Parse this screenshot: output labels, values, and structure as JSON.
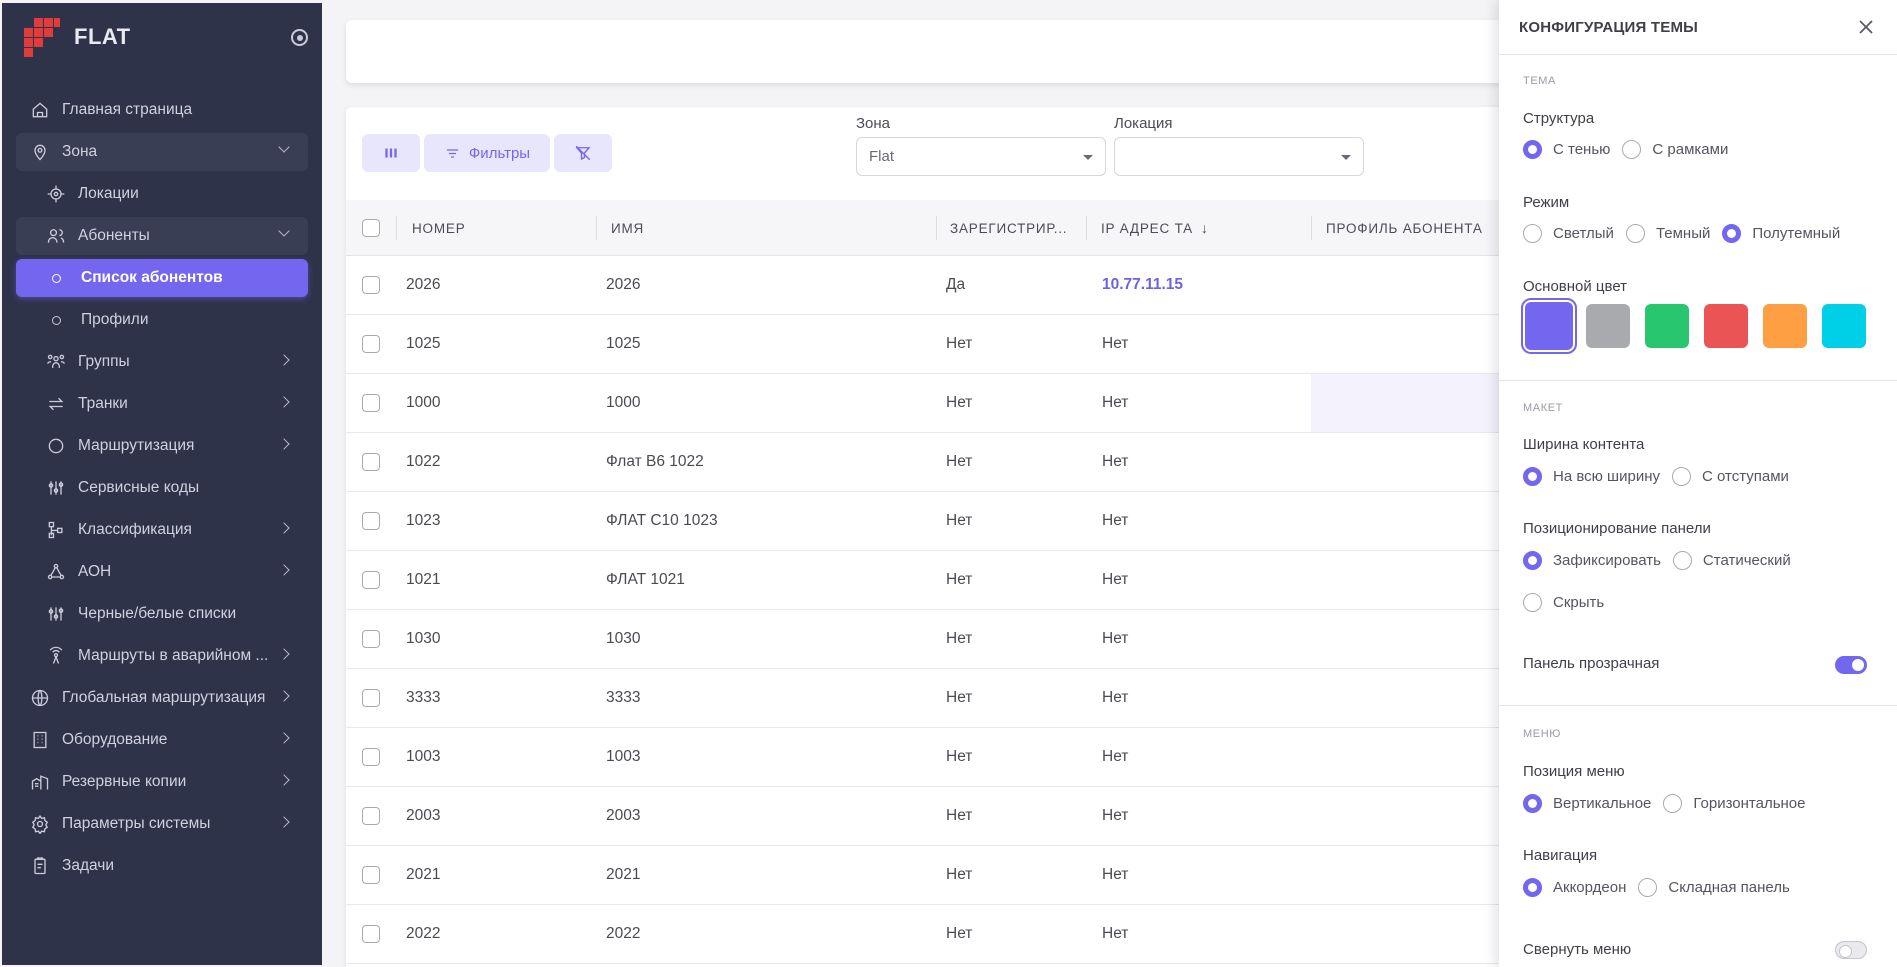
{
  "brand": {
    "name": "FLAT"
  },
  "sidebar": {
    "items": [
      {
        "label": "Главная страница",
        "icon": "home-icon"
      },
      {
        "label": "Зона",
        "icon": "map-pin-icon"
      },
      {
        "label": "Локации",
        "icon": "target-icon"
      },
      {
        "label": "Абоненты",
        "icon": "users-icon"
      },
      {
        "label": "Список абонентов"
      },
      {
        "label": "Профили"
      },
      {
        "label": "Группы",
        "icon": "group-icon"
      },
      {
        "label": "Транки",
        "icon": "arrows-icon"
      },
      {
        "label": "Маршрутизация",
        "icon": "circle-icon"
      },
      {
        "label": "Сервисные коды",
        "icon": "adjustments-icon"
      },
      {
        "label": "Классификация",
        "icon": "hierarchy-icon"
      },
      {
        "label": "АОН",
        "icon": "triangle-nodes-icon"
      },
      {
        "label": "Черные/белые списки",
        "icon": "adjustments-icon"
      },
      {
        "label": "Маршруты в аварийном ...",
        "icon": "antenna-icon"
      },
      {
        "label": "Глобальная маршрутизация",
        "icon": "globe-icon"
      },
      {
        "label": "Оборудование",
        "icon": "building-icon"
      },
      {
        "label": "Резервные копии",
        "icon": "building-community-icon"
      },
      {
        "label": "Параметры системы",
        "icon": "gear-icon"
      },
      {
        "label": "Задачи",
        "icon": "clipboard-icon"
      }
    ]
  },
  "toolbar": {
    "filters_label": "Фильтры",
    "zone_label": "Зона",
    "zone_value": "Flat",
    "location_label": "Локация",
    "location_value": ""
  },
  "table": {
    "columns": [
      "НОМЕР",
      "ИМЯ",
      "ЗАРЕГИСТРИР...",
      "IP АДРЕС ТА",
      "ПРОФИЛЬ АБОНЕНТА"
    ],
    "rows": [
      {
        "number": "2026",
        "name": "2026",
        "registered": "Да",
        "ip": "10.77.11.15"
      },
      {
        "number": "1025",
        "name": "1025",
        "registered": "Нет",
        "ip": "Нет"
      },
      {
        "number": "1000",
        "name": "1000",
        "registered": "Нет",
        "ip": "Нет"
      },
      {
        "number": "1022",
        "name": "Флат В6 1022",
        "registered": "Нет",
        "ip": "Нет"
      },
      {
        "number": "1023",
        "name": "ФЛАТ С10 1023",
        "registered": "Нет",
        "ip": "Нет"
      },
      {
        "number": "1021",
        "name": "ФЛАТ 1021",
        "registered": "Нет",
        "ip": "Нет"
      },
      {
        "number": "1030",
        "name": "1030",
        "registered": "Нет",
        "ip": "Нет"
      },
      {
        "number": "3333",
        "name": "3333",
        "registered": "Нет",
        "ip": "Нет"
      },
      {
        "number": "1003",
        "name": "1003",
        "registered": "Нет",
        "ip": "Нет"
      },
      {
        "number": "2003",
        "name": "2003",
        "registered": "Нет",
        "ip": "Нет"
      },
      {
        "number": "2021",
        "name": "2021",
        "registered": "Нет",
        "ip": "Нет"
      },
      {
        "number": "2022",
        "name": "2022",
        "registered": "Нет",
        "ip": "Нет"
      }
    ]
  },
  "panel": {
    "title": "КОНФИГУРАЦИЯ ТЕМЫ",
    "sec_theme": "Тема",
    "structure_label": "Структура",
    "structure_opt1": "С тенью",
    "structure_opt2": "С рамками",
    "mode_label": "Режим",
    "mode_opt1": "Светлый",
    "mode_opt2": "Темный",
    "mode_opt3": "Полутемный",
    "color_label": "Основной цвет",
    "colors": [
      "#7367f0",
      "#a8aaae",
      "#28c76f",
      "#ea5455",
      "#ff9f43",
      "#00cfe8"
    ],
    "sec_layout": "Макет",
    "width_label": "Ширина контента",
    "width_opt1": "На всю ширину",
    "width_opt2": "С отступами",
    "navbar_label": "Позиционирование панели",
    "navbar_opt1": "Зафиксировать",
    "navbar_opt2": "Статический",
    "navbar_opt3": "Скрыть",
    "transparent_label": "Панель прозрачная",
    "sec_menu": "Меню",
    "menu_pos_label": "Позиция меню",
    "menu_pos_opt1": "Вертикальное",
    "menu_pos_opt2": "Горизонтальное",
    "nav_label": "Навигация",
    "nav_opt1": "Аккордеон",
    "nav_opt2": "Складная панель",
    "collapse_label": "Свернуть меню"
  }
}
